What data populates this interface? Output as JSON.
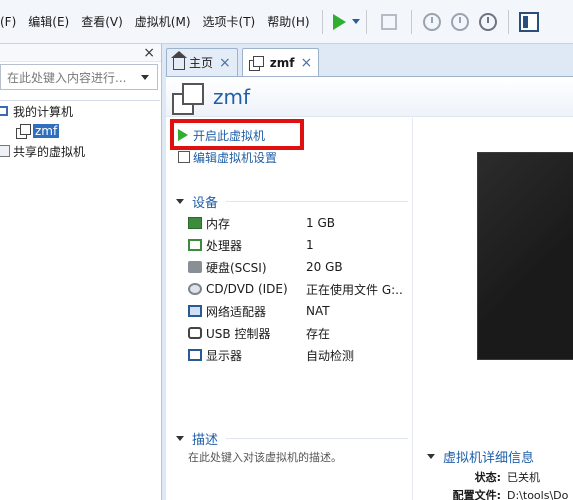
{
  "menu": {
    "items": [
      "(F)",
      "编辑(E)",
      "查看(V)",
      "虚拟机(M)",
      "选项卡(T)",
      "帮助(H)"
    ]
  },
  "library": {
    "close": "×",
    "search_placeholder": "在此处键入内容进行...",
    "tree": {
      "my_computer": "我的计算机",
      "vm": "zmf",
      "shared": "共享的虚拟机"
    }
  },
  "tabs": [
    {
      "label": "主页",
      "close": "×"
    },
    {
      "label": "zmf",
      "close": "×"
    }
  ],
  "vm": {
    "title": "zmf",
    "actions": {
      "power_on": "开启此虚拟机",
      "edit_settings": "编辑虚拟机设置"
    },
    "devices_header": "设备",
    "devices": [
      {
        "icon": "memory-icon",
        "name": "内存",
        "value": "1 GB"
      },
      {
        "icon": "processor-icon",
        "name": "处理器",
        "value": "1"
      },
      {
        "icon": "hard-disk-icon",
        "name": "硬盘(SCSI)",
        "value": "20 GB"
      },
      {
        "icon": "cd-dvd-icon",
        "name": "CD/DVD (IDE)",
        "value": "正在使用文件 G:..."
      },
      {
        "icon": "network-adapter-icon",
        "name": "网络适配器",
        "value": "NAT"
      },
      {
        "icon": "usb-icon",
        "name": "USB 控制器",
        "value": "存在"
      },
      {
        "icon": "display-icon",
        "name": "显示器",
        "value": "自动检测"
      }
    ],
    "description_header": "描述",
    "description_placeholder": "在此处键入对该虚拟机的描述。",
    "details_header": "虚拟机详细信息",
    "details": {
      "state_label": "状态:",
      "state_value": "已关机",
      "config_label": "配置文件:",
      "config_value": "D:\\tools\\Do"
    }
  },
  "colors": {
    "accent": "#1f5fa8",
    "highlight_box": "#e01010",
    "play_green": "#2fae2f"
  }
}
